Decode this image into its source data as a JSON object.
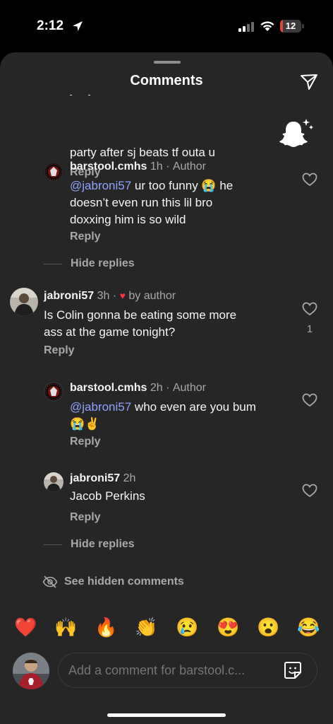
{
  "status_bar": {
    "time": "2:12",
    "battery_level": "12",
    "battery_fraction": 0.12,
    "icons": [
      "location-arrow-icon",
      "cellular-signal-icon",
      "wifi-icon",
      "battery-icon"
    ]
  },
  "sheet": {
    "title": "Comments",
    "share_icon": "paper-plane-icon",
    "snap_icon": "snapchat-ghost-icon"
  },
  "comments": [
    {
      "text_partial": "party after sj beats tf outa u",
      "reply_label": "Reply"
    },
    {
      "username": "barstool.cmhs",
      "time": "1h",
      "badge": "Author",
      "mention": "@jabroni57",
      "text_line1": " ur too funny 😭 he",
      "text_line2": "doesn’t even run this lil bro",
      "text_line3": "doxxing him is so wild",
      "reply_label": "Reply",
      "hide_replies_label": "Hide replies"
    },
    {
      "username": "jabroni57",
      "time": "3h",
      "liked_by": "by author",
      "text_line1": "Is Colin gonna be eating some more",
      "text_line2": "ass at the game tonight?",
      "reply_label": "Reply",
      "like_count": "1"
    },
    {
      "username": "barstool.cmhs",
      "time": "2h",
      "badge": "Author",
      "mention": "@jabroni57",
      "text_line1": " who even are you bum",
      "text_line2": "😭✌️",
      "reply_label": "Reply"
    },
    {
      "username": "jabroni57",
      "time": "2h",
      "text_line1": "Jacob Perkins",
      "reply_label": "Reply",
      "hide_replies_label": "Hide replies"
    }
  ],
  "hidden_comments_label": "See hidden comments",
  "emoji_bar": [
    "❤️",
    "🙌",
    "🔥",
    "👏",
    "😢",
    "😍",
    "😮",
    "😂"
  ],
  "composer": {
    "placeholder": "Add a comment for barstool.c..."
  },
  "colors": {
    "sheet_bg": "#262626",
    "mention": "#8fa2ff",
    "muted": "#a8a8a8",
    "like_heart": "#ff3040"
  }
}
